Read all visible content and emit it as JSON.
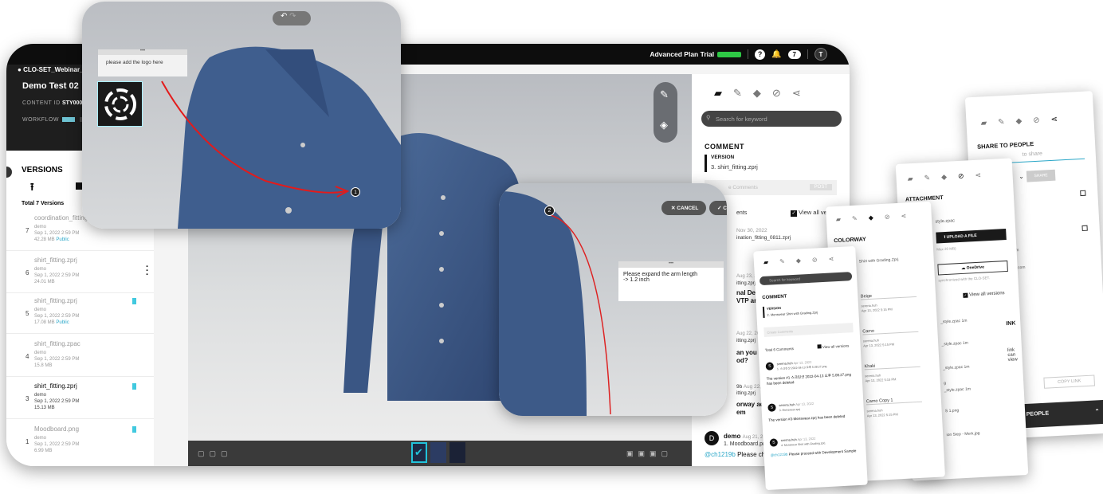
{
  "topbar": {
    "project": "CLO-SET_Webinar_01",
    "plan": "Advanced Plan Trial",
    "help": "?",
    "notif_count": "7",
    "avatar": "T"
  },
  "header": {
    "title": "Demo Test 02",
    "content_id_label": "CONTENT ID",
    "content_id": "STY0000",
    "workflow_label": "WORKFLOW"
  },
  "versions": {
    "title": "VERSIONS",
    "total": "Total 7 Versions",
    "items": [
      {
        "num": "7",
        "name": "coordination_fitting_",
        "user": "demo",
        "date": "Sep 1, 2022 2:59 PM",
        "size": "42.28 MB",
        "public": "Public"
      },
      {
        "num": "6",
        "name": "shirt_fitting.zprj",
        "user": "demo",
        "date": "Sep 1, 2022 2:59 PM",
        "size": "24.01 MB",
        "public": ""
      },
      {
        "num": "5",
        "name": "shirt_fitting.zprj",
        "user": "demo",
        "date": "Sep 1, 2022 2:59 PM",
        "size": "17.08 MB",
        "public": "Public"
      },
      {
        "num": "4",
        "name": "shirt_fitting.zpac",
        "user": "demo",
        "date": "Sep 1, 2022 2:59 PM",
        "size": "15.8 MB",
        "public": ""
      },
      {
        "num": "3",
        "name": "shirt_fitting.zprj",
        "user": "demo",
        "date": "Sep 1, 2022 2:59 PM",
        "size": "15.13 MB",
        "public": ""
      },
      {
        "num": "1",
        "name": "Moodboard.png",
        "user": "demo",
        "date": "Sep 1, 2022 2:59 PM",
        "size": "6.99 MB",
        "public": ""
      }
    ]
  },
  "viewer": {
    "cancel": "✕ CANCEL",
    "confirm": "✓ COM",
    "note_logo": "please add the logo here",
    "note_arm": "Please expand the arm length\n-> 1.2 inch",
    "pin1": "1",
    "pin2": "2",
    "ellipsis": "•••"
  },
  "comment_panel": {
    "search_placeholder": "Search for keyword",
    "section": "COMMENT",
    "version_label": "VERSION",
    "version_value": "3. shirt_fitting.zprj",
    "create_placeholder": "e Comments",
    "post": "POST",
    "count": "ents",
    "view_all": "View all versions",
    "c1_date": "Nov 30, 2022",
    "c1_file": "ination_fitting_0811.zprj",
    "c2_date": "Aug 23, 202",
    "c2_file": "itting.zprj",
    "c2_text": "nal Design",
    "c2_text2": "VTP and pr",
    "c3_date": "Aug 22, 20",
    "c3_file": "itting.zprj",
    "c3_text": "an you ple",
    "c3_text2": "od?",
    "c4_user": "9b",
    "c4_date": "Aug 22,",
    "c4_file": "itting.zprj",
    "c4_text": "orway adop",
    "c4_text2": "em",
    "c5_user": "demo",
    "c5_date": "Aug 21, 20",
    "c5_file": "1. Moodboard.png",
    "c5_mention": "@ch1219b",
    "c5_text": "Please chec",
    "c5_avatar": "D"
  },
  "card_comment": {
    "search_placeholder": "Search for keyword",
    "title": "COMMENT",
    "version_label": "VERSION",
    "version_value": "2. Menswear Shirt with Grading.Zprj",
    "create_placeholder": "Create Comments",
    "total": "Total 6 Comments",
    "view_all": "View all versions",
    "comments": [
      {
        "user": "serena.huh",
        "date": "Apr 13, 2022",
        "file": "1. 스크린샷 2022-04-13 오후 5.08.27.png",
        "text": "The version #1 스크린샷 2022-04-13 오후 5.08.27.png has been deleted",
        "avatar": "S"
      },
      {
        "user": "serena.huh",
        "date": "Apr 13, 2022",
        "file": "3. Menswear.zprj",
        "text": "The version #3-Menswear.zprj has been deleted",
        "avatar": "S"
      },
      {
        "user": "serena.huh",
        "date": "Apr 13, 2022",
        "file": "4. Menswear Shirt with Grading.zprj",
        "mention": "@ch1219b",
        "text": "Please proceed with Development Sample",
        "avatar": "S"
      }
    ]
  },
  "card_colorway": {
    "title": "COLORWAY",
    "file": "Shirt with Grading.Zprj",
    "items": [
      {
        "name": "Beige",
        "user": "serena.huh",
        "date": "Apr 13, 2022 5:15 PM"
      },
      {
        "name": "Camo",
        "user": "serena.huh",
        "date": "Apr 13, 2022 5:15 PM"
      },
      {
        "name": "Khaki",
        "user": "serena.huh",
        "date": "Apr 13, 2022 5:15 PM"
      },
      {
        "name": "Camo Copy 1",
        "user": "serena.huh",
        "date": "Apr 13, 2022 5:15 PM"
      }
    ]
  },
  "card_attachment": {
    "title": "ATTACHMENT",
    "file1": "style.zpac",
    "upload": "UPLOAD A FILE",
    "max": "Max 20 MB)",
    "onedrive": "OneDrive",
    "sync": "synchronized with the CLO-SET.",
    "view_all": "View all versions",
    "files": [
      "_style.zpac",
      "_style.zpac",
      "_style.zpac",
      "_style.zpac"
    ],
    "f_time": "1m",
    "link_title": "INK",
    "link_text": "link can view",
    "png1": "g",
    "png2": "S 1.png",
    "png3": "ion Step - Merk.jpg"
  },
  "card_share": {
    "title": "SHARE TO PEOPLE",
    "placeholder": "to share",
    "share": "SHARE",
    "copy": "COPY LINK",
    "people": "PEOPLE",
    "mail1": "com",
    "mail2": "ng.com"
  }
}
